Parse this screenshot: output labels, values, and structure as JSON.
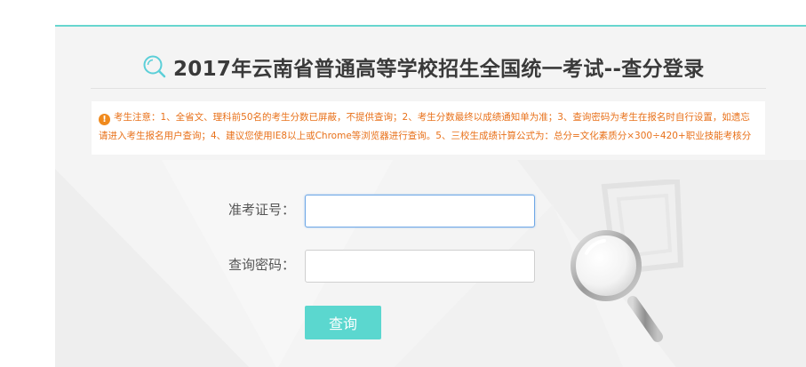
{
  "header": {
    "title": "2017年云南省普通高等学校招生全国统一考试--查分登录",
    "title_icon": "search-icon"
  },
  "notice": {
    "icon": "warning-icon",
    "text": "考生注意：1、全省文、理科前50名的考生分数已屏蔽，不提供查询；2、考生分数最终以成绩通知单为准；3、查询密码为考生在报名时自行设置，如遗忘请进入考生报名用户查询；4、建议您使用IE8以上或Chrome等浏览器进行查询。5、三校生成绩计算公式为：总分=文化素质分×300÷420+职业技能考核分"
  },
  "form": {
    "exam_id_label": "准考证号：",
    "exam_id_value": "",
    "password_label": "查询密码：",
    "password_value": "",
    "submit_label": "查询"
  },
  "colors": {
    "accent": "#5bd7cf",
    "top_border": "#67d6cf",
    "notice_text": "#e8711a",
    "notice_icon": "#f08a1d",
    "title": "#3a3a3a"
  }
}
